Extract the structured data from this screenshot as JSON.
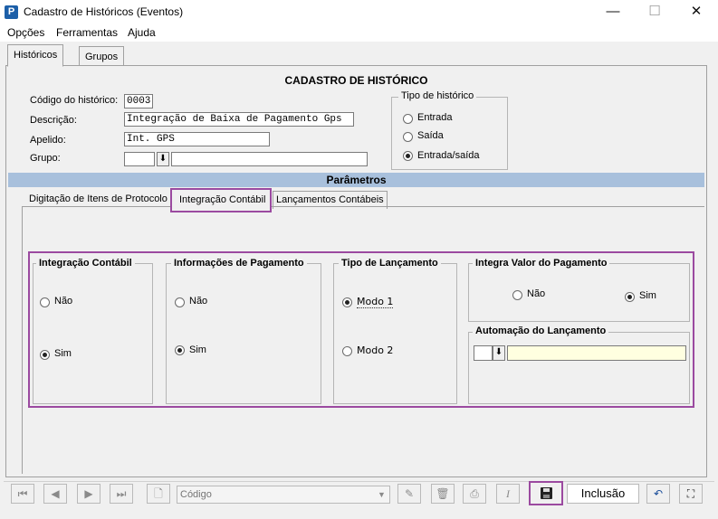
{
  "window": {
    "title": "Cadastro de Históricos (Eventos)",
    "app_icon": "P",
    "icons": [
      "minimize-icon",
      "maximize-icon",
      "close-icon"
    ]
  },
  "menu": {
    "items": [
      "Opções",
      "Ferramentas",
      "Ajuda"
    ]
  },
  "outer_tabs": {
    "historicos": "Históricos",
    "grupos": "Grupos"
  },
  "form": {
    "section_title": "CADASTRO DE HISTÓRICO",
    "codigo_label": "Código do histórico:",
    "codigo_value": "0003",
    "descricao_label": "Descrição:",
    "descricao_value": "Integração de Baixa de Pagamento Gps",
    "apelido_label": "Apelido:",
    "apelido_value": "Int. GPS",
    "grupo_label": "Grupo:",
    "grupo_value": "",
    "grupo_desc_value": ""
  },
  "tipo_historico": {
    "title": "Tipo de histórico",
    "options": [
      "Entrada",
      "Saída",
      "Entrada/saída"
    ],
    "selected": "Entrada/saída"
  },
  "parametros": {
    "title": "Parâmetros",
    "tabs": [
      "Digitação de Itens de Protocolo",
      "Integração Contábil",
      "Lançamentos Contábeis"
    ],
    "active_tab": "Integração Contábil"
  },
  "integracao": {
    "integracao_contabil": {
      "title": "Integração Contábil",
      "options": [
        "Não",
        "Sim"
      ],
      "selected": "Sim"
    },
    "informacoes_pagamento": {
      "title": "Informações de Pagamento",
      "options": [
        "Não",
        "Sim"
      ],
      "selected": "Sim"
    },
    "tipo_lancamento": {
      "title": "Tipo de Lançamento",
      "options": [
        "Modo 1",
        "Modo 2"
      ],
      "selected": "Modo 1"
    },
    "integra_valor": {
      "title": "Integra Valor do Pagamento",
      "options": [
        "Não",
        "Sim"
      ],
      "selected": "Sim"
    },
    "automacao": {
      "title": "Automação do Lançamento",
      "code_value": "",
      "desc_value": ""
    }
  },
  "toolbar": {
    "search_placeholder": "Código",
    "mode_label": "Inclusão",
    "icons": [
      "first-record-icon",
      "prev-record-icon",
      "next-record-icon",
      "last-record-icon",
      "new-document-icon",
      "dropdown-icon",
      "edit-icon",
      "delete-icon",
      "print-icon",
      "italic-icon",
      "save-icon",
      "undo-icon",
      "binoculars-icon"
    ]
  },
  "colors": {
    "highlight": "#9b4aa0",
    "section_header": "#a8c0dc",
    "accent_field": "#ffffe0"
  }
}
